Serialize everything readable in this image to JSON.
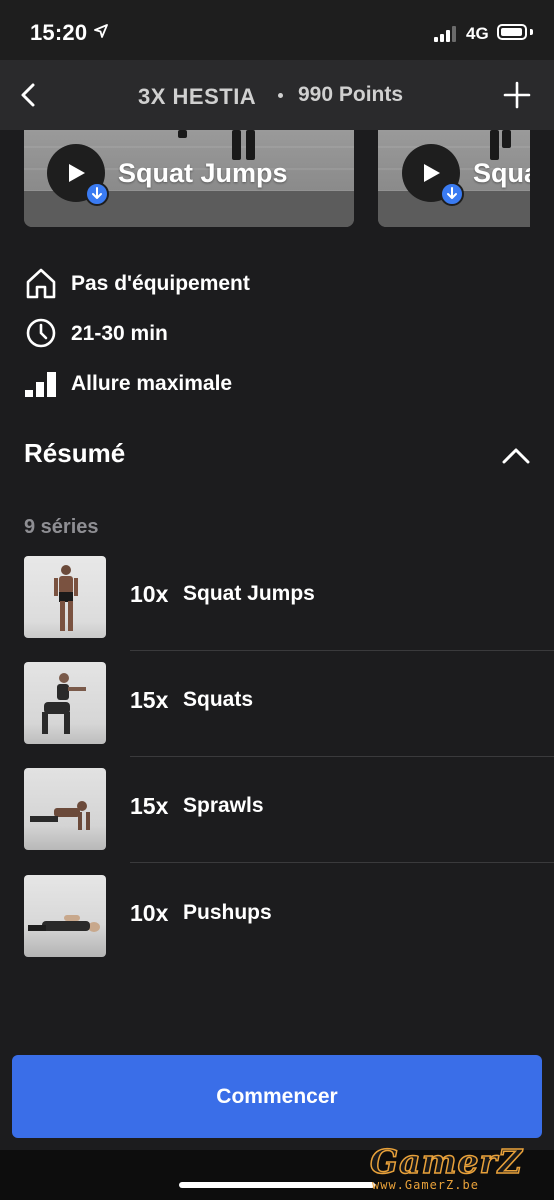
{
  "status_bar": {
    "time": "15:20",
    "network": "4G"
  },
  "nav": {
    "title": "3X HESTIA",
    "points": "990 Points"
  },
  "videos": [
    {
      "label": "Squat Jumps"
    },
    {
      "label": "Squa"
    }
  ],
  "details": {
    "equipment": "Pas d'équipement",
    "duration": "21-30 min",
    "pace": "Allure maximale"
  },
  "summary": {
    "title": "Résumé",
    "series_count": "9 séries",
    "exercises": [
      {
        "count": "10x",
        "name": "Squat Jumps"
      },
      {
        "count": "15x",
        "name": "Squats"
      },
      {
        "count": "15x",
        "name": "Sprawls"
      },
      {
        "count": "10x",
        "name": "Pushups"
      }
    ]
  },
  "start_button": "Commencer",
  "watermark": {
    "logo": "GamerZ",
    "url": "www.GamerZ.be"
  },
  "colors": {
    "accent": "#3a6ee8",
    "background": "#1c1c1e",
    "download_badge": "#3a7bf2"
  }
}
